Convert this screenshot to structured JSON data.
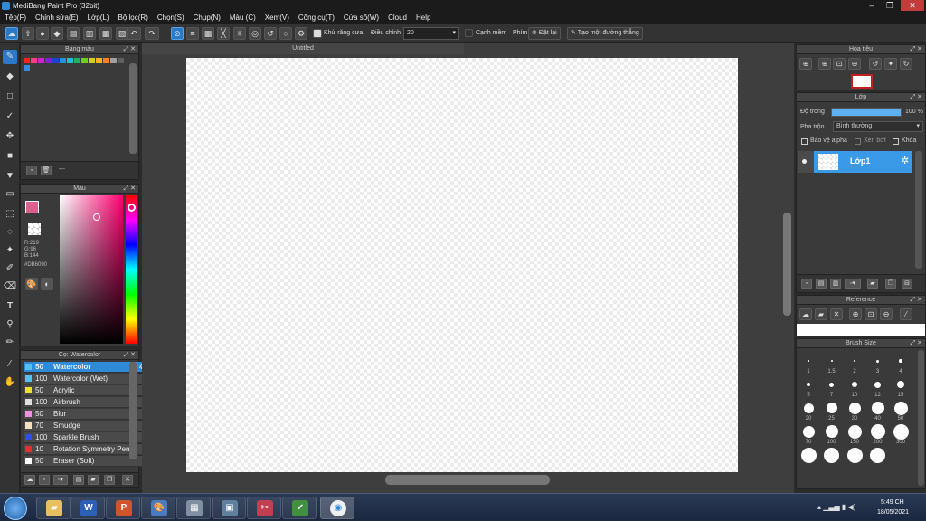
{
  "window": {
    "title": "MediBang Paint Pro (32bit)"
  },
  "menu": [
    "Tệp(F)",
    "Chỉnh sửa(E)",
    "Lớp(L)",
    "Bộ lọc(R)",
    "Chọn(S)",
    "Chụp(N)",
    "Màu (C)",
    "Xem(V)",
    "Công cụ(T)",
    "Cửa sổ(W)",
    "Cloud",
    "Help"
  ],
  "toolbar": {
    "antialias_label": "Khử răng cưa",
    "correction_label": "Điều chỉnh",
    "correction_value": "20",
    "edge_label": "Cạnh mềm",
    "key_label": "Phím",
    "reset_label": "Đặt lại",
    "straight_line_label": "Tạo một đường thẳng"
  },
  "colors": {
    "accent": "#2f8ad8",
    "primary_color": "#DB6090"
  },
  "palette_panel": {
    "title": "Bảng màu",
    "footer_text": "---"
  },
  "palette": [
    "#ff2020",
    "#ff3a8c",
    "#d020d0",
    "#8020d0",
    "#2040d0",
    "#2090e0",
    "#20c0d0",
    "#20b060",
    "#70d020",
    "#d0d020",
    "#ffb020",
    "#ff8020",
    "#a0a0a0",
    "#606060",
    "#3a8ad8"
  ],
  "color_panel": {
    "title": "Màu",
    "r": "R:219",
    "g": "G:96",
    "b": "B:144",
    "hex": "#DB6090"
  },
  "brush_panel": {
    "title": "Cọ: Watercolor",
    "brushes": [
      {
        "size": "50",
        "name": "Watercolor",
        "color": "#56c0f0"
      },
      {
        "size": "100",
        "name": "Watercolor (Wet)",
        "color": "#56c0f0"
      },
      {
        "size": "50",
        "name": "Acrylic",
        "color": "#f0e030"
      },
      {
        "size": "100",
        "name": "Airbrush",
        "color": "#e0e0e0"
      },
      {
        "size": "50",
        "name": "Blur",
        "color": "#f090e0"
      },
      {
        "size": "70",
        "name": "Smudge",
        "color": "#f5e0c0"
      },
      {
        "size": "100",
        "name": "Sparkle Brush",
        "color": "#3050e0"
      },
      {
        "size": "10",
        "name": "Rotation Symmetry Pen",
        "color": "#e03030"
      },
      {
        "size": "50",
        "name": "Eraser (Soft)",
        "color": "#ffffff"
      }
    ]
  },
  "document": {
    "tab": "Untitled"
  },
  "navigator": {
    "title": "Hoa tiêu"
  },
  "layer_panel": {
    "title": "Lớp",
    "opacity_label": "Độ trong",
    "opacity_value": "100 %",
    "opacity": 1.0,
    "blend_label": "Pha trộn",
    "blend_value": "Bình thường",
    "protect_alpha": "Bảo vệ alpha",
    "clipping": "Xén bớt",
    "lock": "Khóa",
    "layers": [
      {
        "name": "Lớp1"
      }
    ]
  },
  "reference_panel": {
    "title": "Reference"
  },
  "brush_size_panel": {
    "title": "Brush Size",
    "sizes": [
      "1",
      "1.5",
      "2",
      "3",
      "4",
      "5",
      "7",
      "10",
      "12",
      "15",
      "20",
      "25",
      "30",
      "40",
      "50",
      "70",
      "100",
      "150",
      "200",
      "300"
    ]
  },
  "taskbar": {
    "time": "5:49 CH",
    "date": "18/05/2021"
  }
}
